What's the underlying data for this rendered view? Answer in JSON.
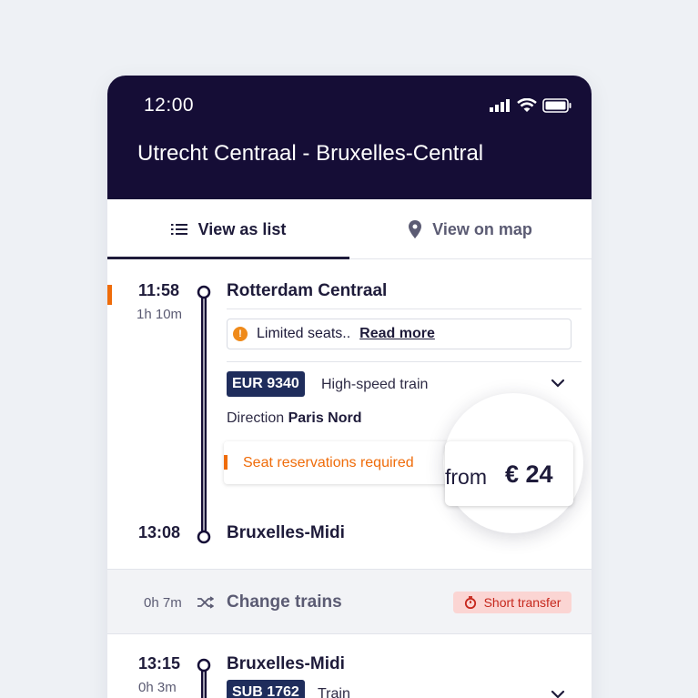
{
  "status_bar": {
    "time": "12:00"
  },
  "header": {
    "title": "Utrecht Centraal - Bruxelles-Central"
  },
  "tabs": [
    {
      "label": "View as list",
      "icon": "list-icon",
      "active": true
    },
    {
      "label": "View on map",
      "icon": "map-pin-icon",
      "active": false
    }
  ],
  "segment1": {
    "departure_time": "11:58",
    "duration": "1h 10m",
    "departure_station": "Rotterdam Centraal",
    "warning": {
      "text": "Limited seats..",
      "link": "Read more"
    },
    "train_number": "EUR 9340",
    "train_type": "High-speed train",
    "direction_label": "Direction",
    "direction_value": "Paris Nord",
    "reservation_note": "Seat reservations required",
    "arrival_time": "13:08",
    "arrival_station": "Bruxelles-Midi"
  },
  "price": {
    "from_label": "from",
    "amount": "€ 24"
  },
  "change": {
    "duration": "0h 7m",
    "label": "Change trains",
    "badge": "Short transfer"
  },
  "segment2": {
    "departure_time": "13:15",
    "duration": "0h 3m",
    "departure_station": "Bruxelles-Midi",
    "train_number": "SUB 1762",
    "train_type": "Train"
  },
  "colors": {
    "header_bg": "#150d36",
    "accent_orange": "#ef6c0a",
    "badge_navy": "#1f2d5c",
    "danger_red": "#c6271c"
  }
}
